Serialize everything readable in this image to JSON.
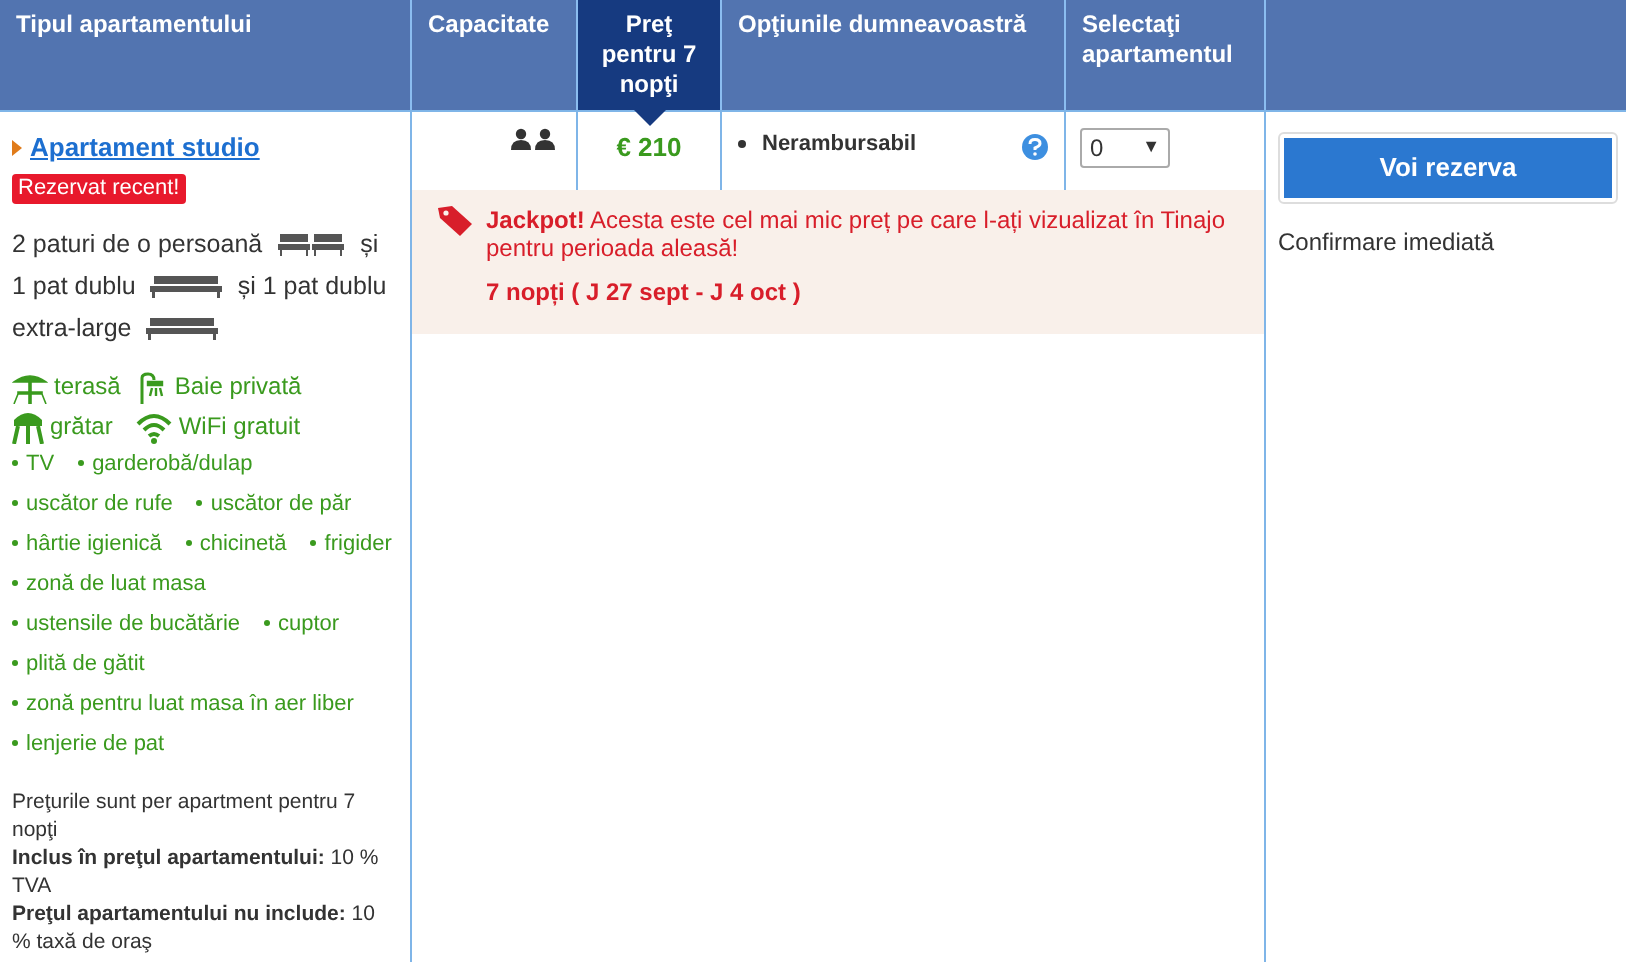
{
  "table": {
    "columns": [
      {
        "label": "Tipul apartamentului",
        "selected": false
      },
      {
        "label": "Capacitate",
        "selected": false
      },
      {
        "label": "Preţ pentru 7 nopţi",
        "selected": true
      },
      {
        "label": "Opţiunile dumneavoastră",
        "selected": false
      },
      {
        "label": "Selectaţi apartamentul",
        "selected": false
      },
      {
        "selected": false
      }
    ]
  },
  "room": {
    "name": "Apartament studio",
    "badge": "Rezervat recent!",
    "beds": [
      {
        "kind": "text",
        "text": "2 paturi de o persoană"
      },
      {
        "kind": "single_beds"
      },
      {
        "kind": "text",
        "text": "și"
      },
      {
        "kind": "text",
        "text": "1 pat dublu"
      },
      {
        "kind": "double_bed"
      },
      {
        "kind": "text",
        "text": "și 1 pat dublu"
      },
      {
        "kind": "text",
        "text": "extra-large"
      },
      {
        "kind": "double_bed"
      }
    ],
    "facilities": [
      {
        "kind": "terrace",
        "text": "terasă"
      },
      {
        "kind": "bath",
        "text": "Baie privată"
      },
      {
        "kind": "grill",
        "text": "grătar"
      },
      {
        "kind": "wifi",
        "text": "WiFi gratuit"
      }
    ],
    "amenities": [
      "TV",
      "garderobă/dulap",
      "uscător de rufe",
      "uscător de păr",
      "hârtie igienică",
      "chicinetă",
      "frigider",
      "zonă de luat masa",
      "ustensile de bucătărie",
      "cuptor",
      "plită de gătit",
      "zonă pentru luat masa în aer liber",
      "lenjerie de pat"
    ],
    "notes": [
      "Preţurile sunt per apartment pentru 7 nopţi",
      "**Inclus în preţul apartamentului:** 10 % TVA",
      "**Preţul apartamentului nu include:** 10 % taxă de oraş"
    ]
  },
  "capacity": {
    "icons": [
      {
        "kind": "person"
      },
      {
        "kind": "person"
      }
    ]
  },
  "price": "€ 210",
  "option": "Nerambursabil",
  "quantity": "0",
  "caret": "▼",
  "jackpot": {
    "title": "Jackpot!",
    "text": "Acesta este cel mai mic preț pe care l-ați vizualizat în Tinajo pentru perioada aleasă!",
    "dates": "7 nopți ( J 27 sept - J 4 oct )"
  },
  "book_button": "Voi rezerva",
  "confirmation": "Confirmare imediată"
}
